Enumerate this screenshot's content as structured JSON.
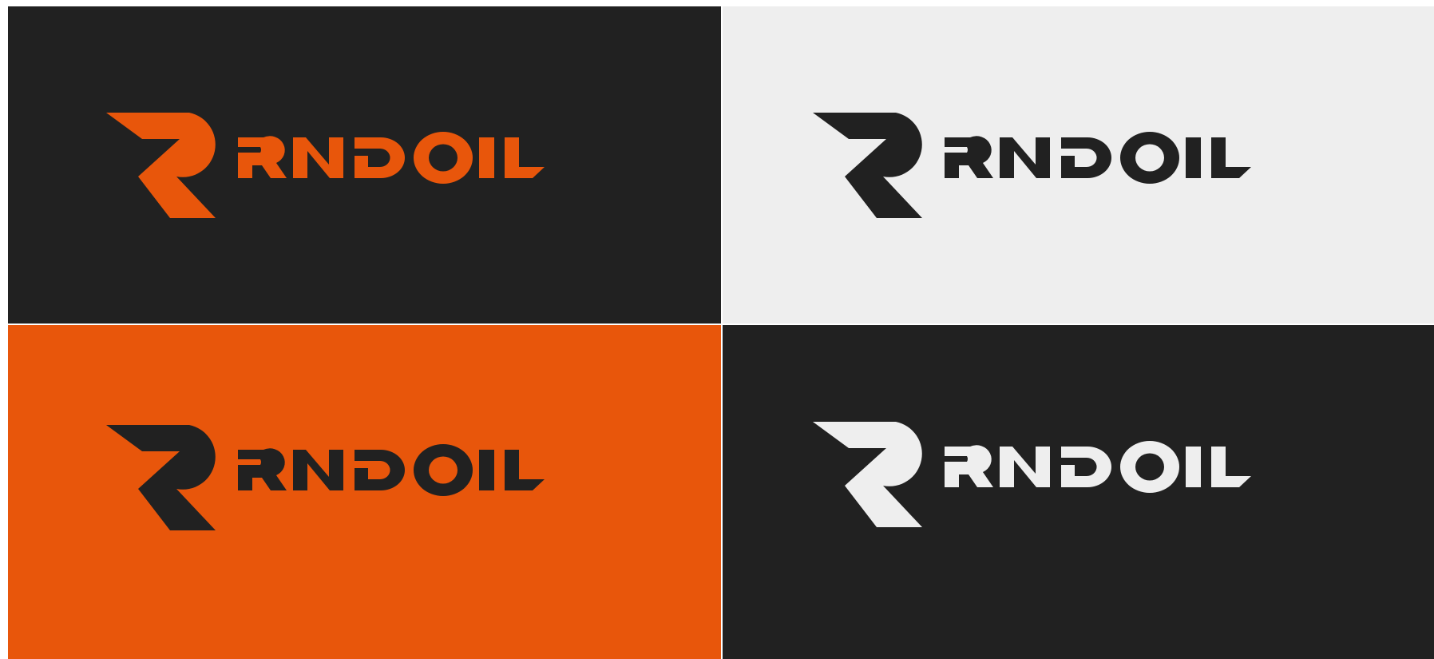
{
  "brand": {
    "wordmark": "RNDOIL",
    "colors": {
      "dark": "#212121",
      "orange": "#E8560B",
      "light": "#EEEEEE"
    }
  },
  "variants": [
    {
      "name": "orange-on-dark",
      "background": "#212121",
      "foreground": "#E8560B"
    },
    {
      "name": "dark-on-light",
      "background": "#EEEEEE",
      "foreground": "#212121"
    },
    {
      "name": "dark-on-orange",
      "background": "#E8560B",
      "foreground": "#212121"
    },
    {
      "name": "light-on-dark",
      "background": "#212121",
      "foreground": "#EEEEEE"
    }
  ]
}
